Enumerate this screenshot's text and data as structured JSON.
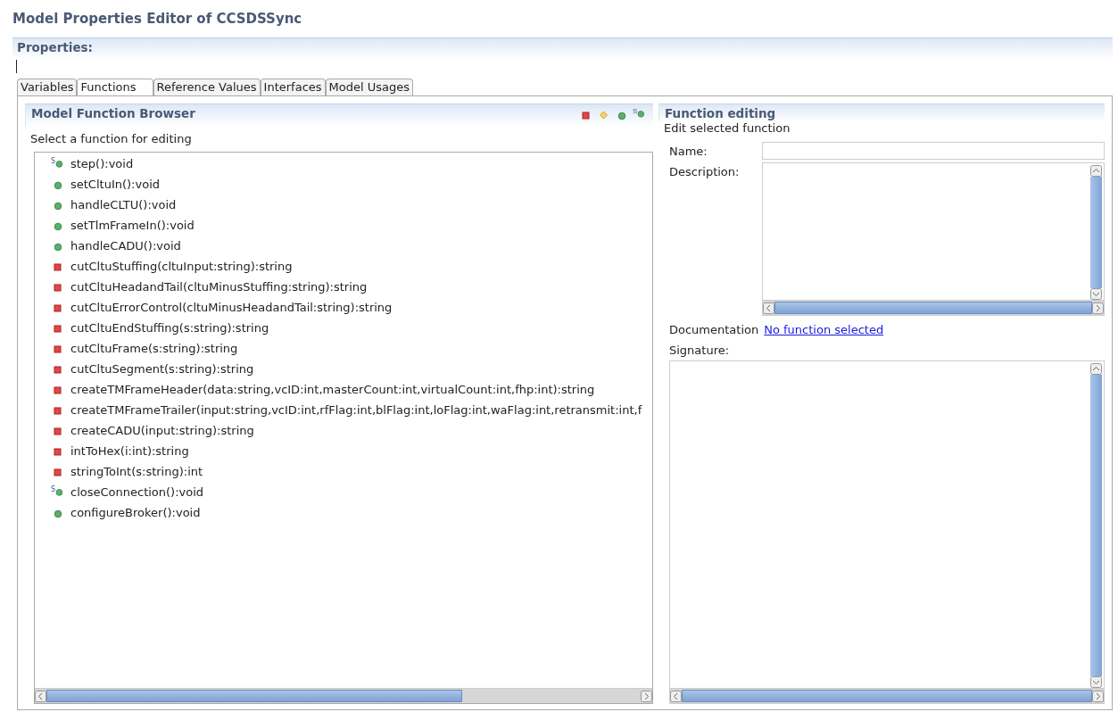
{
  "window": {
    "title": "Model Properties Editor of CCSDSSync"
  },
  "properties": {
    "title": "Properties:"
  },
  "tabs": [
    {
      "label": "Variables",
      "selected": false
    },
    {
      "label": "Functions",
      "selected": true
    },
    {
      "label": "Reference Values",
      "selected": false
    },
    {
      "label": "Interfaces",
      "selected": false
    },
    {
      "label": "Model Usages",
      "selected": false
    }
  ],
  "browser": {
    "title": "Model Function Browser",
    "hint": "Select a function for editing",
    "filters": [
      {
        "kind": "private"
      },
      {
        "kind": "protected"
      },
      {
        "kind": "public"
      },
      {
        "kind": "public",
        "badge": "S"
      }
    ],
    "functions": [
      {
        "kind": "public",
        "badge": "S",
        "label": "step():void"
      },
      {
        "kind": "public",
        "label": "setCltuIn():void"
      },
      {
        "kind": "public",
        "label": "handleCLTU():void"
      },
      {
        "kind": "public",
        "label": "setTlmFrameIn():void"
      },
      {
        "kind": "public",
        "label": "handleCADU():void"
      },
      {
        "kind": "private",
        "label": "cutCltuStuffing(cltuInput:string):string"
      },
      {
        "kind": "private",
        "label": "cutCltuHeadandTail(cltuMinusStuffing:string):string"
      },
      {
        "kind": "private",
        "label": "cutCltuErrorControl(cltuMinusHeadandTail:string):string"
      },
      {
        "kind": "private",
        "label": "cutCltuEndStuffing(s:string):string"
      },
      {
        "kind": "private",
        "label": "cutCltuFrame(s:string):string"
      },
      {
        "kind": "private",
        "label": "cutCltuSegment(s:string):string"
      },
      {
        "kind": "private",
        "label": "createTMFrameHeader(data:string,vcID:int,masterCount:int,virtualCount:int,fhp:int):string"
      },
      {
        "kind": "private",
        "label": "createTMFrameTrailer(input:string,vcID:int,rfFlag:int,blFlag:int,loFlag:int,waFlag:int,retransmit:int,f"
      },
      {
        "kind": "private",
        "label": "createCADU(input:string):string"
      },
      {
        "kind": "private",
        "label": "intToHex(i:int):string"
      },
      {
        "kind": "private",
        "label": "stringToInt(s:string):int"
      },
      {
        "kind": "public",
        "badge": "S",
        "label": "closeConnection():void"
      },
      {
        "kind": "public",
        "label": "configureBroker():void"
      }
    ]
  },
  "editing": {
    "title": "Function editing",
    "hint": "Edit selected function",
    "name_label": "Name:",
    "description_label": "Description:",
    "documentation_label": "Documentation",
    "documentation_link": "No function selected",
    "signature_label": "Signature:"
  }
}
